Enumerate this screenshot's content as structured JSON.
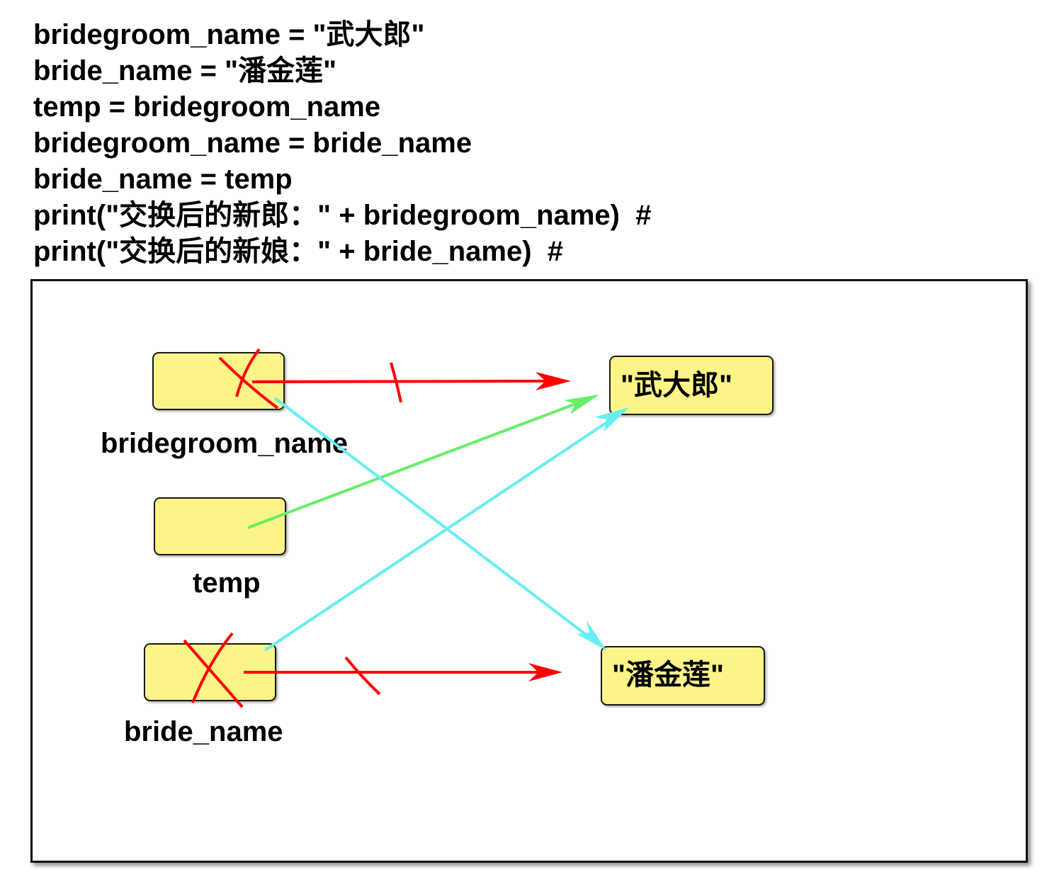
{
  "code_lines": [
    "bridegroom_name = \"武大郎\"",
    "bride_name = \"潘金莲\"",
    "temp = bridegroom_name",
    "bridegroom_name = bride_name",
    "bride_name = temp",
    "print(\"交换后的新郎：\" + bridegroom_name)  #",
    "print(\"交换后的新娘：\" + bride_name)  #"
  ],
  "diagram": {
    "variables": {
      "bridegroom": {
        "label": "bridegroom_name",
        "crossed_out": true
      },
      "temp": {
        "label": "temp",
        "crossed_out": false
      },
      "bride": {
        "label": "bride_name",
        "crossed_out": true
      }
    },
    "values": {
      "wudalang": "\"武大郎\"",
      "panjinlian": "\"潘金莲\""
    },
    "references": [
      {
        "from": "bridegroom_name",
        "to": "\"武大郎\"",
        "color": "#ff0000",
        "state": "removed"
      },
      {
        "from": "bride_name",
        "to": "\"潘金莲\"",
        "color": "#ff0000",
        "state": "removed"
      },
      {
        "from": "temp",
        "to": "\"武大郎\"",
        "color": "#66ee66",
        "state": "active"
      },
      {
        "from": "bridegroom_name",
        "to": "\"潘金莲\"",
        "color": "#66eef2",
        "state": "active"
      },
      {
        "from": "bride_name",
        "to": "\"武大郎\"",
        "color": "#66eef2",
        "state": "active"
      }
    ],
    "colors": {
      "box_fill": "#fbf487",
      "removed_reference": "#ff0000",
      "temp_reference": "#66ee66",
      "swapped_reference": "#66eef2"
    }
  }
}
